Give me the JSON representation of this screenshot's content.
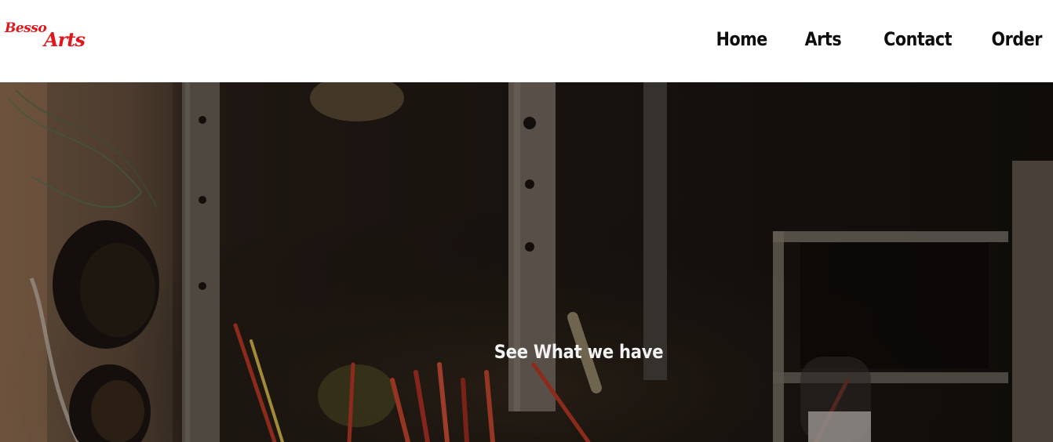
{
  "header": {
    "logo": {
      "line1": "Besso",
      "line2": "Arts"
    },
    "nav": [
      {
        "label": "Home"
      },
      {
        "label": "Arts"
      },
      {
        "label": "Contact"
      },
      {
        "label": "Order"
      }
    ]
  },
  "hero": {
    "title": "See What we have"
  },
  "colors": {
    "brand": "#e3161c",
    "nav_text": "#0d0d0d",
    "hero_text": "#f2f2f2"
  }
}
